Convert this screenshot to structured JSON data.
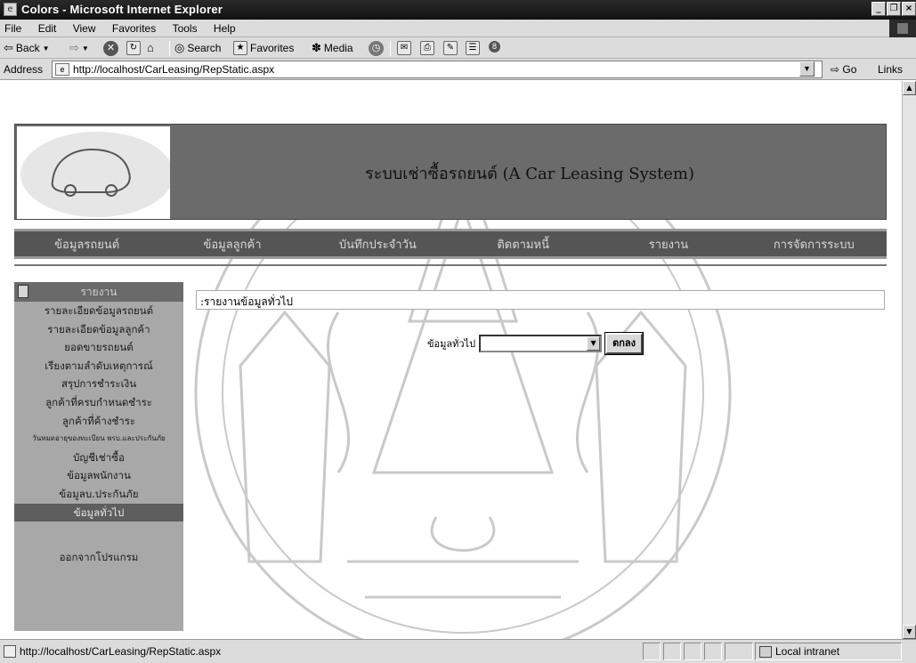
{
  "window": {
    "title": "Colors - Microsoft Internet Explorer"
  },
  "menubar": {
    "items": [
      "File",
      "Edit",
      "View",
      "Favorites",
      "Tools",
      "Help"
    ]
  },
  "toolbar": {
    "back": "Back",
    "search": "Search",
    "favorites": "Favorites",
    "media": "Media"
  },
  "addressbar": {
    "label": "Address",
    "url": "http://localhost/CarLeasing/RepStatic.aspx",
    "go": "Go",
    "links": "Links"
  },
  "page": {
    "banner_title": "ระบบเช่าซื้อรถยนต์ (A Car Leasing System)",
    "nav": [
      "ข้อมูลรถยนต์",
      "ข้อมูลลูกค้า",
      "บันทึกประจำวัน",
      "ติดตามหนี้",
      "รายงาน",
      "การจัดการระบบ"
    ],
    "sidebar": {
      "heading": "รายงาน",
      "items": [
        "รายละเอียดข้อมูลรถยนต์",
        "รายละเอียดข้อมูลลูกค้า",
        "ยอดขายรถยนต์",
        "เรียงตามลำดับเหตุการณ์",
        "สรุปการชำระเงิน",
        "ลูกค้าที่ครบกำหนดชำระ",
        "ลูกค้าที่ค้างชำระ",
        "วันหมดอายุของทะเบียน พรบ.และประกันภัย",
        "บัญชีเช่าซื้อ",
        "ข้อมูลพนักงาน",
        "ข้อมูลบ.ประกันภัย",
        "ข้อมูลทั่วไป"
      ],
      "active_index": 11,
      "exit": "ออกจากโปรแกรม"
    },
    "section_title": ":รายงานข้อมูลทั่วไป",
    "form": {
      "label": "ข้อมูลทั่วไป",
      "select_value": "",
      "ok_button": "ตกลง"
    }
  },
  "statusbar": {
    "url": "http://localhost/CarLeasing/RepStatic.aspx",
    "zone": "Local intranet"
  }
}
